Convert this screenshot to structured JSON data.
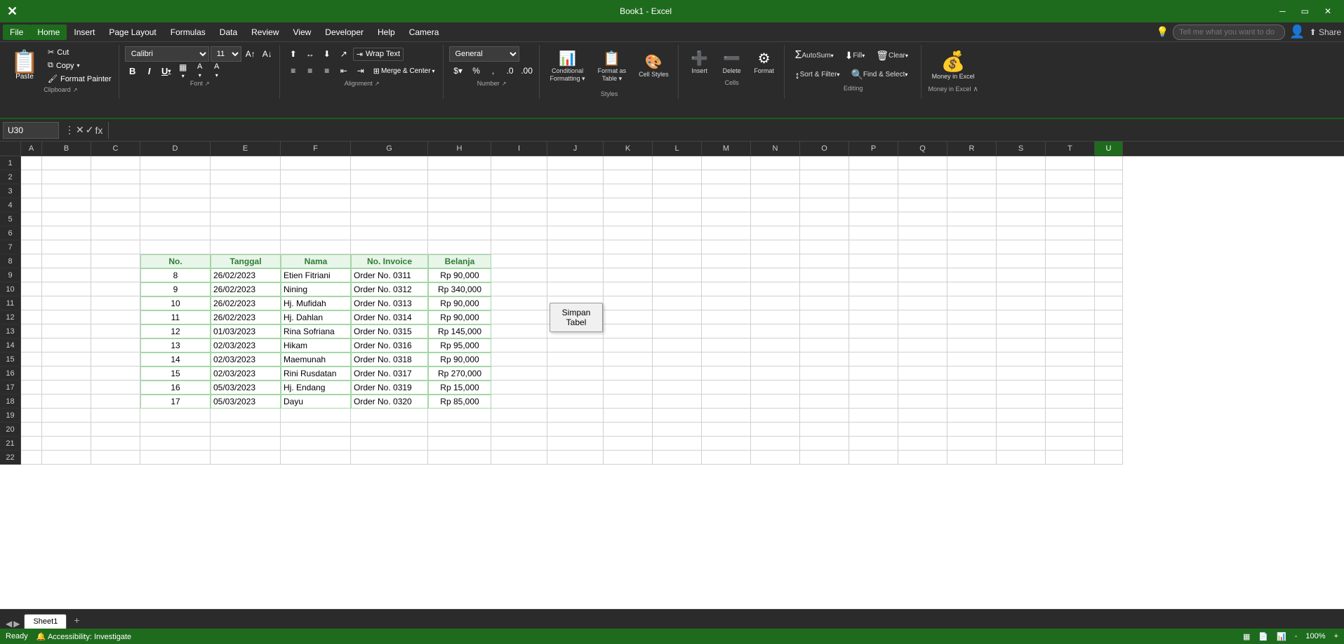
{
  "titlebar": {
    "title": "Book1 - Excel",
    "windowControls": [
      "minimize",
      "restore",
      "close"
    ]
  },
  "menubar": {
    "items": [
      {
        "label": "File",
        "id": "file"
      },
      {
        "label": "Home",
        "id": "home",
        "active": true
      },
      {
        "label": "Insert",
        "id": "insert"
      },
      {
        "label": "Page Layout",
        "id": "page-layout"
      },
      {
        "label": "Formulas",
        "id": "formulas"
      },
      {
        "label": "Data",
        "id": "data"
      },
      {
        "label": "Review",
        "id": "review"
      },
      {
        "label": "View",
        "id": "view"
      },
      {
        "label": "Developer",
        "id": "developer"
      },
      {
        "label": "Help",
        "id": "help"
      },
      {
        "label": "Camera",
        "id": "camera"
      }
    ],
    "searchPlaceholder": "Tell me what you want to do"
  },
  "ribbon": {
    "groups": {
      "clipboard": {
        "label": "Clipboard",
        "paste_label": "Paste",
        "cut_label": "Cut",
        "copy_label": "Copy",
        "format_painter_label": "Format Painter"
      },
      "font": {
        "label": "Font",
        "font_family": "Calibri",
        "font_size": "11",
        "bold_label": "B",
        "italic_label": "I",
        "underline_label": "U"
      },
      "alignment": {
        "label": "Alignment",
        "wrap_text_label": "Wrap Text",
        "merge_label": "Merge & Center"
      },
      "number": {
        "label": "Number",
        "format": "General"
      },
      "styles": {
        "label": "Styles",
        "conditional_formatting": "Conditional Formatting",
        "format_as_table": "Format as Table",
        "cell_styles": "Cell Styles"
      },
      "cells": {
        "label": "Cells",
        "insert_label": "Insert",
        "delete_label": "Delete",
        "format_label": "Format"
      },
      "editing": {
        "label": "Editing",
        "autosum_label": "AutoSum",
        "fill_label": "Fill",
        "clear_label": "Clear",
        "sort_filter_label": "Sort & Filter",
        "find_select_label": "Find & Select"
      },
      "money_in_excel": {
        "label": "Money in Excel",
        "btn_label": "Money in Excel"
      }
    }
  },
  "formulabar": {
    "cell_ref": "U30",
    "formula": ""
  },
  "columns": [
    "A",
    "B",
    "C",
    "D",
    "E",
    "F",
    "G",
    "H",
    "I",
    "J",
    "K",
    "L",
    "M",
    "N",
    "O",
    "P",
    "Q",
    "R",
    "S",
    "T",
    "U"
  ],
  "rows": [
    1,
    2,
    3,
    4,
    5,
    6,
    7,
    8,
    9,
    10,
    11,
    12,
    13,
    14,
    15,
    16,
    17,
    18,
    19,
    20,
    21,
    22
  ],
  "table": {
    "headers": [
      "No.",
      "Tanggal",
      "Nama",
      "No. Invoice",
      "Belanja"
    ],
    "header_row": 8,
    "start_col": "D",
    "rows": [
      {
        "no": "8",
        "tanggal": "26/02/2023",
        "nama": "Etien Fitriani",
        "invoice": "Order No. 0311",
        "belanja": "Rp 90,000"
      },
      {
        "no": "9",
        "tanggal": "26/02/2023",
        "nama": "Nining",
        "invoice": "Order No. 0312",
        "belanja": "Rp 340,000"
      },
      {
        "no": "10",
        "tanggal": "26/02/2023",
        "nama": "Hj. Mufidah",
        "invoice": "Order No. 0313",
        "belanja": "Rp 90,000"
      },
      {
        "no": "11",
        "tanggal": "26/02/2023",
        "nama": "Hj. Dahlan",
        "invoice": "Order No. 0314",
        "belanja": "Rp 90,000"
      },
      {
        "no": "12",
        "tanggal": "01/03/2023",
        "nama": "Rina Sofriana",
        "invoice": "Order No. 0315",
        "belanja": "Rp 145,000"
      },
      {
        "no": "13",
        "tanggal": "02/03/2023",
        "nama": "Hikam",
        "invoice": "Order No. 0316",
        "belanja": "Rp 95,000"
      },
      {
        "no": "14",
        "tanggal": "02/03/2023",
        "nama": "Maemunah",
        "invoice": "Order No. 0318",
        "belanja": "Rp 90,000"
      },
      {
        "no": "15",
        "tanggal": "02/03/2023",
        "nama": "Rini Rusdatan",
        "invoice": "Order No. 0317",
        "belanja": "Rp 270,000"
      },
      {
        "no": "16",
        "tanggal": "05/03/2023",
        "nama": "Hj. Endang",
        "invoice": "Order No. 0319",
        "belanja": "Rp 15,000"
      },
      {
        "no": "17",
        "tanggal": "05/03/2023",
        "nama": "Dayu",
        "invoice": "Order No. 0320",
        "belanja": "Rp 85,000"
      }
    ]
  },
  "simpan_tabel_label": "Simpan Tabel",
  "sheet_tabs": [
    "Sheet1"
  ],
  "status": {
    "items": [
      "Ready",
      "Accessibility: Investigate"
    ]
  }
}
